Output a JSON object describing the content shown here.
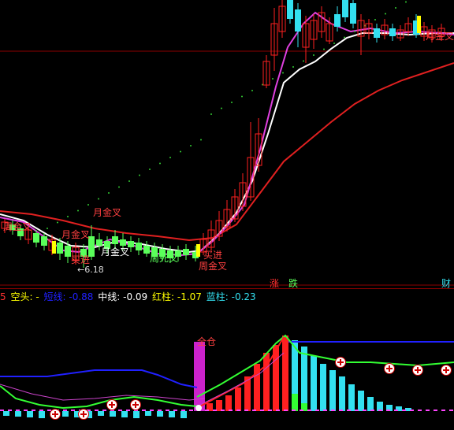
{
  "colors": {
    "background": "#000000",
    "up": "#ff2020",
    "down": "#5aff5a",
    "cyan": "#33e0f0",
    "white_ma": "#ffffff",
    "magenta_ma": "#e040e0",
    "red_ma": "#e02020",
    "yellow": "#ffff00",
    "blue_line": "#2020ff",
    "green_line": "#33ff33",
    "pink_line": "#cc44cc"
  },
  "main_panel": {
    "signals": [
      {
        "label": "月金叉",
        "color": "#ff4040"
      },
      {
        "label": "周金叉",
        "color": "#ff4040"
      },
      {
        "label": "月金叉",
        "color": "#ffffff"
      },
      {
        "label": "周死叉",
        "color": "#5aff5a"
      },
      {
        "label": "月金叉",
        "color": "#ff4040"
      },
      {
        "label": "买进",
        "color": "#ff4040"
      },
      {
        "label": "周金叉",
        "color": "#ff4040"
      },
      {
        "label": "买进",
        "color": "#ff4040"
      },
      {
        "label": "月金叉",
        "color": "#ff4040"
      }
    ],
    "low_marker": "←6.18",
    "tabs": [
      {
        "label": "涨",
        "color": "#ff3030"
      },
      {
        "label": "跌",
        "color": "#5aff5a"
      },
      {
        "label": "财",
        "color": "#33e0f0"
      }
    ]
  },
  "indicator_legend": [
    {
      "text": "5",
      "color": "#ff3030"
    },
    {
      "text": "空头: -",
      "color": "#ffff00"
    },
    {
      "text": "短线: -0.88",
      "color": "#2020ff"
    },
    {
      "text": "中线: -0.09",
      "color": "#ffffff"
    },
    {
      "text": "红柱: -1.07",
      "color": "#ffff00"
    },
    {
      "text": "蓝柱: -0.23",
      "color": "#33e0f0"
    }
  ],
  "sub_panel": {
    "label_full_position": "全仓"
  },
  "chart_data": {
    "type": "candlestick",
    "low_label": "6.18",
    "indicator_values": {
      "short": -0.88,
      "mid": -0.09,
      "red_bar": -1.07,
      "blue_bar": -0.23
    }
  }
}
